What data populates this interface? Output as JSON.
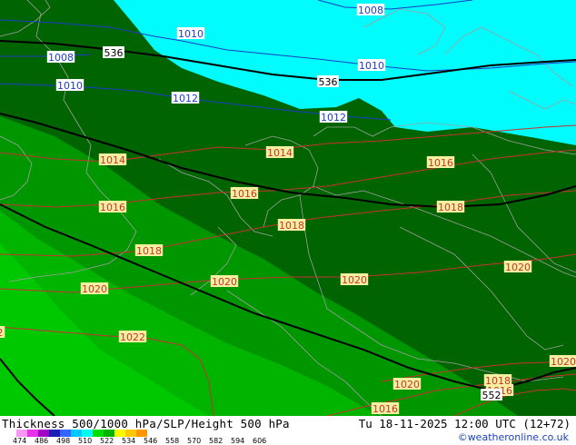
{
  "map": {
    "title": "Thickness 500/1000 hPa/SLP/Height 500 hPa",
    "valid_time": "Tu 18-11-2025 12:00 UTC (12+72)",
    "credit": "©weatheronline.co.uk",
    "colors": {
      "cold_1": "#00fcfc",
      "band_534": "#006400",
      "band_546": "#009600",
      "band_558": "#00b400",
      "band_570": "#00c800",
      "isobar_low": "#1e3cc8",
      "isobar_high": "#c83232",
      "height_line": "#000000",
      "coast": "#a0a0a0"
    },
    "scale": {
      "ticks": [
        "474",
        "486",
        "498",
        "510",
        "522",
        "534",
        "546",
        "558",
        "570",
        "582",
        "594",
        "606"
      ],
      "colors": [
        "#fa96fa",
        "#e632e6",
        "#a000c8",
        "#1e1eb4",
        "#3264ff",
        "#00c8ff",
        "#00fcfc",
        "#00dc00",
        "#00b400",
        "#fafa00",
        "#ffc800",
        "#ff9600"
      ]
    },
    "labels": [
      {
        "text": "1008",
        "kind": "low"
      },
      {
        "text": "1010",
        "kind": "low"
      },
      {
        "text": "1008",
        "kind": "low"
      },
      {
        "text": "1010",
        "kind": "low"
      },
      {
        "text": "1010",
        "kind": "low"
      },
      {
        "text": "1012",
        "kind": "low"
      },
      {
        "text": "1012",
        "kind": "low"
      },
      {
        "text": "536",
        "kind": "height"
      },
      {
        "text": "536",
        "kind": "height"
      },
      {
        "text": "1014",
        "kind": "high"
      },
      {
        "text": "1014",
        "kind": "high"
      },
      {
        "text": "1016",
        "kind": "high"
      },
      {
        "text": "1016",
        "kind": "high"
      },
      {
        "text": "1016",
        "kind": "high"
      },
      {
        "text": "1018",
        "kind": "high"
      },
      {
        "text": "1018",
        "kind": "high"
      },
      {
        "text": "1018",
        "kind": "high"
      },
      {
        "text": "1020",
        "kind": "high"
      },
      {
        "text": "1020",
        "kind": "high"
      },
      {
        "text": "1020",
        "kind": "high"
      },
      {
        "text": "1020",
        "kind": "high"
      },
      {
        "text": "1020",
        "kind": "high"
      },
      {
        "text": "1020",
        "kind": "high"
      },
      {
        "text": "1022",
        "kind": "high"
      },
      {
        "text": "1018",
        "kind": "high"
      },
      {
        "text": "1016",
        "kind": "high"
      },
      {
        "text": "1016",
        "kind": "high"
      },
      {
        "text": "552",
        "kind": "height"
      },
      {
        "text": "2",
        "kind": "high"
      }
    ]
  }
}
